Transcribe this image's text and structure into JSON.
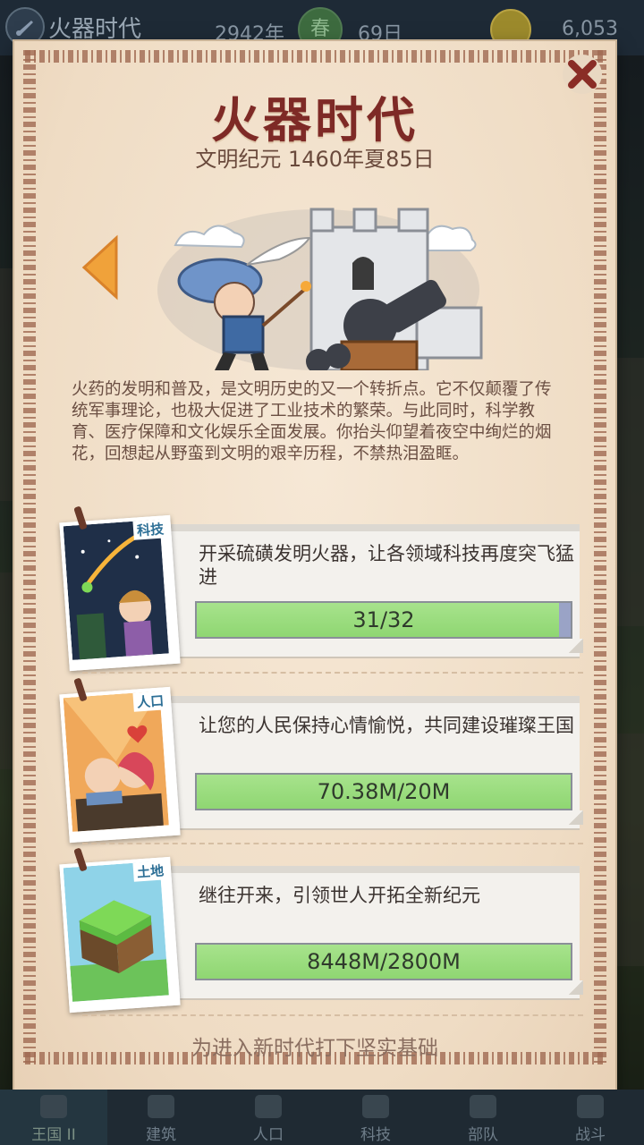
{
  "topbar": {
    "era_name": "火器时代",
    "year": "2942年",
    "season": "春",
    "day": "69日",
    "gold": "6,053"
  },
  "dialog": {
    "title": "火器时代",
    "subtitle": "文明纪元 1460年夏85日",
    "description": "火药的发明和普及，是文明历史的又一个转折点。它不仅颠覆了传统军事理论，也极大促进了工业技术的繁荣。与此同时，科学教育、医疗保障和文化娱乐全面发展。你抬头仰望着夜空中绚烂的烟花，回想起从野蛮到文明的艰辛历程，不禁热泪盈眶。",
    "footer": "为进入新时代打下坚实基础",
    "tasks": [
      {
        "tag": "科技",
        "text": "开采硫磺发明火器，让各领域科技再度突飞猛进",
        "progress": "31/32",
        "fraction": 0.969
      },
      {
        "tag": "人口",
        "text": "让您的人民保持心情愉悦，共同建设璀璨王国",
        "progress": "70.38M/20M",
        "fraction": 1.0
      },
      {
        "tag": "土地",
        "text": "继往开来，引领世人开拓全新纪元",
        "progress": "8448M/2800M",
        "fraction": 1.0
      }
    ]
  },
  "nav": {
    "tabs": [
      "王国 II",
      "建筑",
      "人口",
      "科技",
      "部队",
      "战斗"
    ]
  }
}
